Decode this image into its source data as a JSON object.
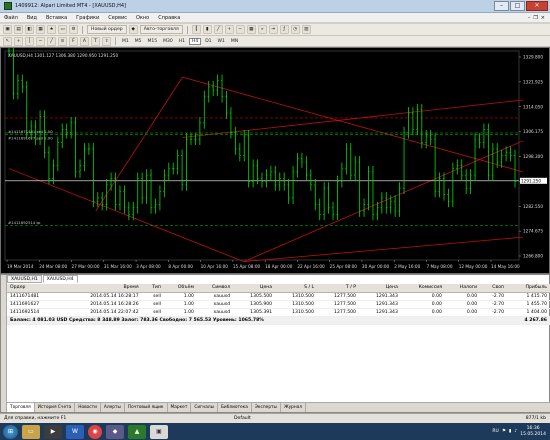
{
  "window": {
    "title": "1409912: Alpari Limited MT4 - [XAUUSD,H4]"
  },
  "menu": [
    "Файл",
    "Вид",
    "Вставка",
    "Графики",
    "Сервис",
    "Окно",
    "Справка"
  ],
  "toolbar1": {
    "autotrade_label": "Авто-торговля",
    "new_order_label": "Новый ордер"
  },
  "toolbar2": {
    "timeframes": [
      "M1",
      "M5",
      "M15",
      "M30",
      "H1",
      "H4",
      "D1",
      "W1",
      "MN"
    ]
  },
  "chart": {
    "info": "XAUUSD,H4  1301.127 1306.380 1290.950 1291.250",
    "annotations": [
      {
        "label": "#1411671481 sell 1.00",
        "price": 1305.5
      },
      {
        "label": "#1411691627 sell 1.00",
        "price": 1305.9
      },
      {
        "label": "#1411692514 tp",
        "price": 1277.5
      }
    ],
    "current_price_label": "1291.250"
  },
  "chart_data": {
    "type": "line",
    "symbol": "XAUUSD",
    "timeframe": "H4",
    "ylim": [
      1267.0,
      1331.0
    ],
    "ytick_labels": [
      "1329.800",
      "1321.925",
      "1314.050",
      "1306.175",
      "1298.300",
      "1290.425",
      "1282.550",
      "1274.675",
      "1266.800"
    ],
    "xtick_labels": [
      "19 Mar 2014",
      "24 Mar 08:00",
      "27 Mar 00:00",
      "31 Mar 16:00",
      "3 Apr 08:00",
      "8 Apr 00:00",
      "10 Apr 16:00",
      "15 Apr 08:00",
      "18 Apr 00:00",
      "22 Apr 16:00",
      "25 Apr 08:00",
      "30 Apr 00:00",
      "2 May 16:00",
      "7 May 08:00",
      "12 May 00:00",
      "14 May 16:00"
    ],
    "close_series": [
      1331,
      1318,
      1322,
      1320,
      1306,
      1308,
      1304,
      1311,
      1300,
      1292,
      1296,
      1303,
      1307,
      1306,
      1309,
      1294,
      1296,
      1301,
      1301,
      1285,
      1286,
      1284,
      1290,
      1292,
      1284,
      1288,
      1283,
      1281,
      1283,
      1292,
      1286,
      1293,
      1283,
      1284,
      1288,
      1293,
      1295,
      1295,
      1299,
      1290,
      1304,
      1304,
      1304,
      1309,
      1317,
      1320,
      1319,
      1322,
      1317,
      1312,
      1306,
      1301,
      1299,
      1305,
      1291,
      1296,
      1292,
      1291,
      1293,
      1294,
      1290,
      1292,
      1290,
      1286,
      1294,
      1298,
      1297,
      1293,
      1290,
      1284,
      1281,
      1289,
      1283,
      1281,
      1291,
      1295,
      1301,
      1293,
      1297,
      1282,
      1284,
      1294,
      1281,
      1283,
      1286,
      1283,
      1285,
      1282,
      1289,
      1306,
      1312,
      1307,
      1313,
      1303,
      1305,
      1304,
      1288,
      1292,
      1287,
      1285,
      1295,
      1296,
      1293,
      1289,
      1293,
      1304,
      1303,
      1307,
      1293,
      1301,
      1297,
      1299,
      1300,
      1299,
      1291
    ],
    "level_lines": [
      {
        "name": "order_open_1",
        "value": 1305.5,
        "color": "#00a000"
      },
      {
        "name": "order_open_2",
        "value": 1305.9,
        "color": "#00a000"
      },
      {
        "name": "stop_loss",
        "value": 1310.5,
        "color": "#d00000"
      },
      {
        "name": "take_profit",
        "value": 1277.5,
        "color": "#00a000"
      },
      {
        "name": "current",
        "value": 1291.25,
        "color": "#ffffff"
      }
    ]
  },
  "terminal": {
    "headers": [
      "Ордер",
      "Время",
      "Тип",
      "Объём",
      "Символ",
      "Цена",
      "S / L",
      "T / P",
      "Цена",
      "Комиссия",
      "Налоги",
      "Своп",
      "Прибыль"
    ],
    "orders": [
      [
        "1411671481",
        "2014.05.14 16:28:17",
        "sell",
        "1.00",
        "xauusd",
        "1305.500",
        "1310.500",
        "1277.500",
        "1291.343",
        "0.00",
        "0.00",
        "-2.70",
        "1 415.70"
      ],
      [
        "1411691627",
        "2014.05.14 16:28:26",
        "sell",
        "1.00",
        "xauusd",
        "1305.900",
        "1310.500",
        "1277.500",
        "1291.343",
        "0.00",
        "0.00",
        "-2.70",
        "1 455.70"
      ],
      [
        "1411692514",
        "2014.05.14 22:07:42",
        "sell",
        "1.00",
        "xauusd",
        "1305.391",
        "1310.500",
        "1277.500",
        "1291.343",
        "0.00",
        "0.00",
        "-2.70",
        "1 404.00"
      ]
    ],
    "balance_text": "Баланс: 4 081.03 USD  Средства: 8 348.89  Залог: 783.36  Свободно: 7 565.53  Уровень: 1065.78%",
    "total_profit": "4 267.86",
    "tabs": [
      "Торговля",
      "История Счета",
      "Новости",
      "Алерты",
      "Почтовый ящик",
      "Маркет",
      "Сигналы",
      "Библиотека",
      "Эксперты",
      "Журнал"
    ],
    "chart_tabs": [
      "XAUUSD,H1",
      "XAUUSD,H4"
    ]
  },
  "statusbar": {
    "help": "Для справки, нажмите F1",
    "profile": "Default",
    "connection": "877/1 kb"
  },
  "taskbar": {
    "lang": "RU",
    "time": "16:36",
    "date": "15.05.2014"
  }
}
